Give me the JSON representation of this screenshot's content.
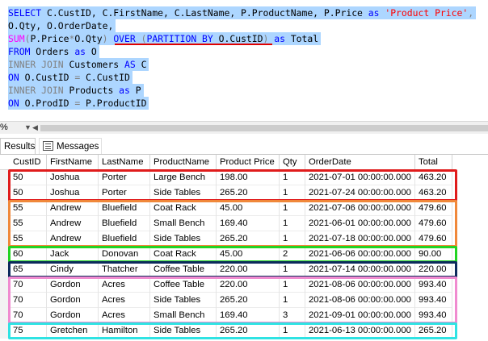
{
  "editor": {
    "lines": [
      {
        "parts": [
          {
            "t": "SELECT ",
            "c": "kw"
          },
          {
            "t": "C.CustID, C.FirstName, C.LastName, P.ProductName, P.Price ",
            "c": "ident"
          },
          {
            "t": "as ",
            "c": "kw"
          },
          {
            "t": "'Product Price'",
            "c": "str"
          },
          {
            "t": ",",
            "c": "gray"
          }
        ]
      },
      {
        "parts": [
          {
            "t": "O.Qty, O.OrderDate,",
            "c": "ident"
          }
        ]
      },
      {
        "parts": [
          {
            "t": "SUM",
            "c": "fn"
          },
          {
            "t": "(",
            "c": "gray"
          },
          {
            "t": "P.Price",
            "c": "ident"
          },
          {
            "t": "*",
            "c": "gray"
          },
          {
            "t": "O.Qty",
            "c": "ident"
          },
          {
            "t": ") ",
            "c": "gray"
          },
          {
            "t": "OVER ",
            "c": "kw"
          },
          {
            "t": "(",
            "c": "gray"
          },
          {
            "t": "PARTITION BY ",
            "c": "kw"
          },
          {
            "t": "O.CustID",
            "c": "ident"
          },
          {
            "t": ") ",
            "c": "gray"
          },
          {
            "t": "as ",
            "c": "kw"
          },
          {
            "t": "Total",
            "c": "ident"
          }
        ]
      },
      {
        "parts": [
          {
            "t": "FROM ",
            "c": "kw"
          },
          {
            "t": "Orders ",
            "c": "ident"
          },
          {
            "t": "as ",
            "c": "kw"
          },
          {
            "t": "O",
            "c": "ident"
          }
        ]
      },
      {
        "parts": [
          {
            "t": "INNER JOIN ",
            "c": "gray"
          },
          {
            "t": "Customers ",
            "c": "ident"
          },
          {
            "t": "AS ",
            "c": "kw"
          },
          {
            "t": "C",
            "c": "ident"
          }
        ]
      },
      {
        "parts": [
          {
            "t": "ON ",
            "c": "kw"
          },
          {
            "t": "O.CustID ",
            "c": "ident"
          },
          {
            "t": "= ",
            "c": "gray"
          },
          {
            "t": "C.CustID",
            "c": "ident"
          }
        ]
      },
      {
        "parts": [
          {
            "t": "INNER JOIN ",
            "c": "gray"
          },
          {
            "t": "Products ",
            "c": "ident"
          },
          {
            "t": "as ",
            "c": "kw"
          },
          {
            "t": "P",
            "c": "ident"
          }
        ]
      },
      {
        "parts": [
          {
            "t": "ON ",
            "c": "kw"
          },
          {
            "t": "O.ProdID ",
            "c": "ident"
          },
          {
            "t": "= ",
            "c": "gray"
          },
          {
            "t": "P.ProductID",
            "c": "ident"
          }
        ]
      }
    ]
  },
  "zoom": {
    "label": "%"
  },
  "tabs": {
    "results": "Results",
    "messages": "Messages"
  },
  "grid": {
    "columns": [
      "CustID",
      "FirstName",
      "LastName",
      "ProductName",
      "Product Price",
      "Qty",
      "OrderDate",
      "Total"
    ],
    "rows": [
      [
        "50",
        "Joshua",
        "Porter",
        "Large Bench",
        "198.00",
        "1",
        "2021-07-01 00:00:00.000",
        "463.20"
      ],
      [
        "50",
        "Joshua",
        "Porter",
        "Side Tables",
        "265.20",
        "1",
        "2021-07-24 00:00:00.000",
        "463.20"
      ],
      [
        "55",
        "Andrew",
        "Bluefield",
        "Coat Rack",
        "45.00",
        "1",
        "2021-07-06 00:00:00.000",
        "479.60"
      ],
      [
        "55",
        "Andrew",
        "Bluefield",
        "Small Bench",
        "169.40",
        "1",
        "2021-06-01 00:00:00.000",
        "479.60"
      ],
      [
        "55",
        "Andrew",
        "Bluefield",
        "Side Tables",
        "265.20",
        "1",
        "2021-07-18 00:00:00.000",
        "479.60"
      ],
      [
        "60",
        "Jack",
        "Donovan",
        "Coat Rack",
        "45.00",
        "2",
        "2021-06-06 00:00:00.000",
        "90.00"
      ],
      [
        "65",
        "Cindy",
        "Thatcher",
        "Coffee Table",
        "220.00",
        "1",
        "2021-07-14 00:00:00.000",
        "220.00"
      ],
      [
        "70",
        "Gordon",
        "Acres",
        "Coffee Table",
        "220.00",
        "1",
        "2021-08-06 00:00:00.000",
        "993.40"
      ],
      [
        "70",
        "Gordon",
        "Acres",
        "Side Tables",
        "265.20",
        "1",
        "2021-08-06 00:00:00.000",
        "993.40"
      ],
      [
        "70",
        "Gordon",
        "Acres",
        "Small Bench",
        "169.40",
        "3",
        "2021-09-01 00:00:00.000",
        "993.40"
      ],
      [
        "75",
        "Gretchen",
        "Hamilton",
        "Side Tables",
        "265.20",
        "1",
        "2021-06-13 00:00:00.000",
        "265.20"
      ]
    ],
    "groups": [
      {
        "custid": "50",
        "color": "#e01b1b"
      },
      {
        "custid": "55",
        "color": "#f0883a"
      },
      {
        "custid": "60",
        "color": "#22d322"
      },
      {
        "custid": "65",
        "color": "#0d2a5c"
      },
      {
        "custid": "70",
        "color": "#f08bd0"
      },
      {
        "custid": "75",
        "color": "#2fe3e3"
      }
    ],
    "partition_underline_color": "#e00000"
  }
}
